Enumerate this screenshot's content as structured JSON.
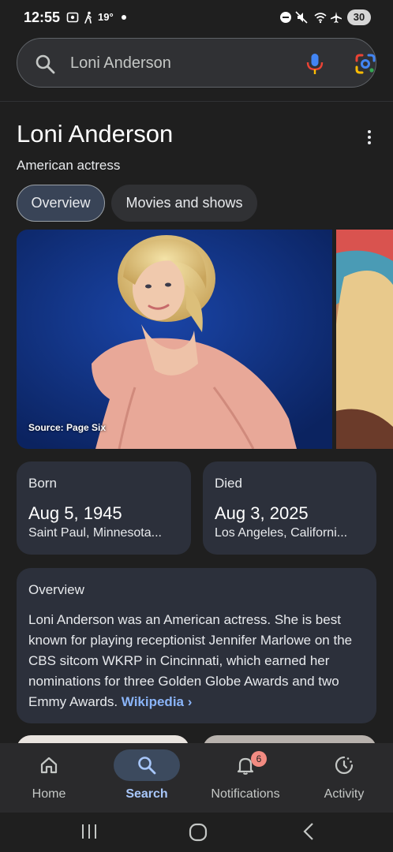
{
  "status_bar": {
    "time": "12:55",
    "temperature": "19°",
    "battery": "30",
    "icons": [
      "screenshot-icon",
      "walking-icon",
      "do-not-disturb-icon",
      "mute-icon",
      "wifi-icon",
      "airplane-icon",
      "battery-icon"
    ]
  },
  "search": {
    "query": "Loni Anderson",
    "icons": [
      "search-icon",
      "mic-icon",
      "lens-icon"
    ]
  },
  "entity": {
    "name": "Loni Anderson",
    "description": "American actress"
  },
  "tabs": [
    {
      "label": "Overview",
      "active": true
    },
    {
      "label": "Movies and shows",
      "active": false
    }
  ],
  "image": {
    "source": "Source: Page Six"
  },
  "born": {
    "label": "Born",
    "date": "Aug 5, 1945",
    "place": "Saint Paul, Minnesota..."
  },
  "died": {
    "label": "Died",
    "date": "Aug 3, 2025",
    "place": "Los Angeles, Californi..."
  },
  "overview": {
    "label": "Overview",
    "text": "Loni Anderson was an American actress. She is best known for playing receptionist Jennifer Marlowe on the CBS sitcom WKRP in Cincinnati, which earned her nominations for three Golden Globe Awards and two Emmy Awards.",
    "link": "Wikipedia"
  },
  "bottom_nav": [
    {
      "label": "Home",
      "icon": "home-icon",
      "active": false
    },
    {
      "label": "Search",
      "icon": "search-icon",
      "active": true
    },
    {
      "label": "Notifications",
      "icon": "bell-icon",
      "active": false,
      "badge": "6"
    },
    {
      "label": "Activity",
      "icon": "activity-icon",
      "active": false
    }
  ],
  "colors": {
    "background": "#1f1f1f",
    "card": "#2c303b",
    "link": "#8ab4f8",
    "active_nav": "#a8c7fa"
  }
}
